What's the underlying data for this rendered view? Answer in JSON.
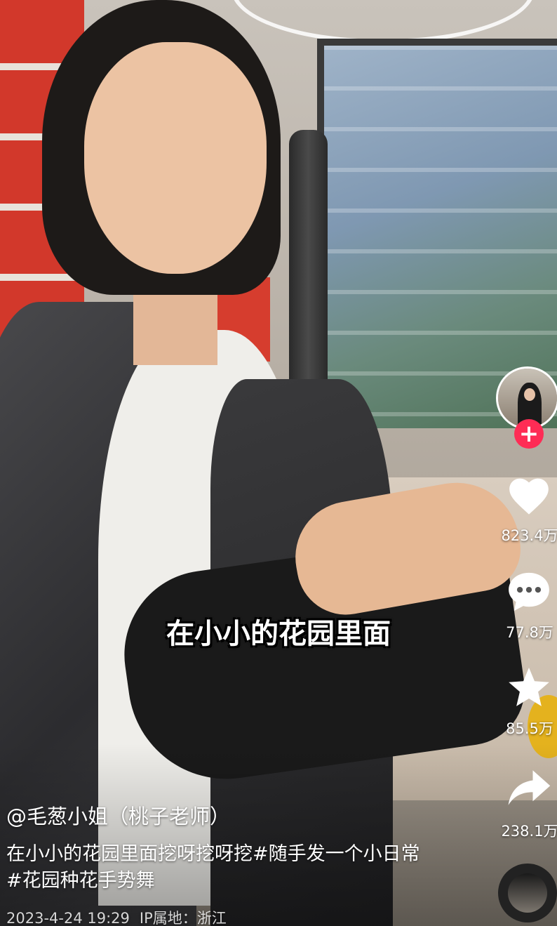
{
  "video": {
    "caption": "在小小的花园里面"
  },
  "creator": {
    "handle": "@毛葱小姐（桃子老师）",
    "description_main": "在小小的花园里面挖呀挖呀挖",
    "hashtag_1": "#随手发一个小日常",
    "hashtag_2": "#花园种花手势舞",
    "date": "2023-4-24 19:29",
    "ip_location": "IP属地：浙江",
    "follow_symbol": "+"
  },
  "actions": {
    "likes": "823.4万",
    "comments": "77.8万",
    "favorites": "85.5万",
    "shares": "238.1万"
  },
  "icons": [
    "heart-icon",
    "comment-icon",
    "star-icon",
    "share-icon",
    "plus-icon"
  ],
  "colors": {
    "follow_accent": "#fe2c55",
    "text": "#ffffff"
  }
}
